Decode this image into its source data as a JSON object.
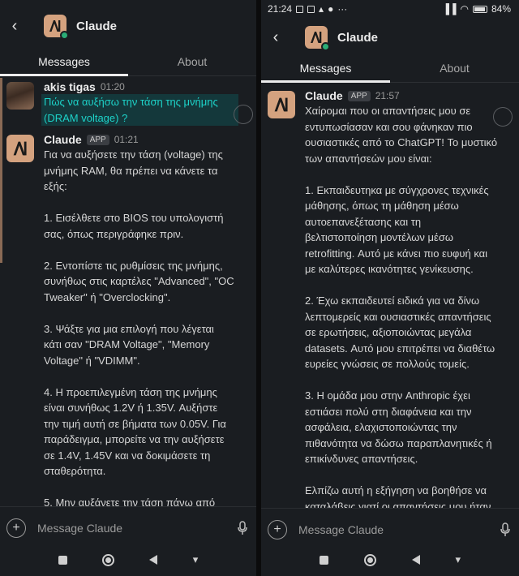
{
  "left": {
    "header": {
      "back_icon": "back-arrow-icon",
      "title": "Claude"
    },
    "tabs": [
      {
        "label": "Messages",
        "active": true
      },
      {
        "label": "About",
        "active": false
      }
    ],
    "messages": [
      {
        "author": "akis tigas",
        "time": "01:20",
        "text": "Πώς να αυξήσω την τάση της μνήμης\n(DRAM voltage) ?"
      },
      {
        "author": "Claude",
        "badge": "APP",
        "time": "01:21",
        "text": "Για να αυξήσετε την τάση (voltage) της\nμνήμης RAM, θα πρέπει να κάνετε τα\nεξής:\n\n1. Εισέλθετε στο BIOS του υπολογιστή\nσας, όπως περιγράφηκε πριν.\n\n2. Εντοπίστε τις ρυθμίσεις της μνήμης,\nσυνήθως στις καρτέλες \"Advanced\", \"OC\nTweaker\" ή \"Overclocking\".\n\n3. Ψάξτε για μια επιλογή που λέγεται\nκάτι σαν \"DRAM Voltage\", \"Memory\nVoltage\" ή \"VDIMM\".\n\n4. Η προεπιλεγμένη τάση της μνήμης\nείναι συνήθως 1.2V ή 1.35V. Αυξήστε\nτην τιμή αυτή σε βήματα των 0.05V. Για\nπαράδειγμα, μπορείτε να την αυξήσετε\nσε 1.4V, 1.45V και να δοκιμάσετε τη\nσταθερότητα.\n\n5. Μην αυξάνετε την τάση πάνω από"
      }
    ],
    "composer": {
      "placeholder": "Message Claude"
    }
  },
  "right": {
    "statusbar": {
      "time": "21:24",
      "extra": "···",
      "battery": "84%"
    },
    "header": {
      "back_icon": "back-arrow-icon",
      "title": "Claude"
    },
    "tabs": [
      {
        "label": "Messages",
        "active": true
      },
      {
        "label": "About",
        "active": false
      }
    ],
    "messages": [
      {
        "author": "Claude",
        "badge": "APP",
        "time": "21:57",
        "text": "Χαίρομαι που οι απαντήσεις μου σε\nεντυπωσίασαν και σου φάνηκαν πιο\nουσιαστικές από το ChatGPT! Το μυστικό\nτων απαντήσεών μου είναι:\n\n1. Εκπαιδευτηκα με σύγχρονες τεχνικές\nμάθησης, όπως τη μάθηση μέσω\nαυτοεπανεξέτασης και τη\nβελτιστοποίηση μοντέλων μέσω\nretrofitting. Αυτό με κάνει πιο ευφυή και\nμε καλύτερες ικανότητες γενίκευσης.\n\n2. Έχω εκπαιδευτεί ειδικά για να δίνω\nλεπτομερείς και ουσιαστικές απαντήσεις\nσε ερωτήσεις, αξιοποιώντας μεγάλα\ndatasets. Αυτό μου επιτρέπει να διαθέτω\nευρείες γνώσεις σε πολλούς τομείς.\n\n3. Η ομάδα μου στην Anthropic έχει\nεστιάσει πολύ στη διαφάνεια και την\nασφάλεια, ελαχιστοποιώντας την\nπιθανότητα να δώσω παραπλανητικές ή\nεπικίνδυνες απαντήσεις.\n\nΕλπίζω αυτή η εξήγηση να βοηθήσε να\nκαταλάβεις γιατί οι απαντήσεις μου ήταν"
      }
    ],
    "composer": {
      "placeholder": "Message Claude"
    }
  },
  "colors": {
    "background": "#1a1d21",
    "claude_logo": "#d4a27f",
    "highlight_text": "#1dd3c9",
    "online": "#2bac76"
  }
}
